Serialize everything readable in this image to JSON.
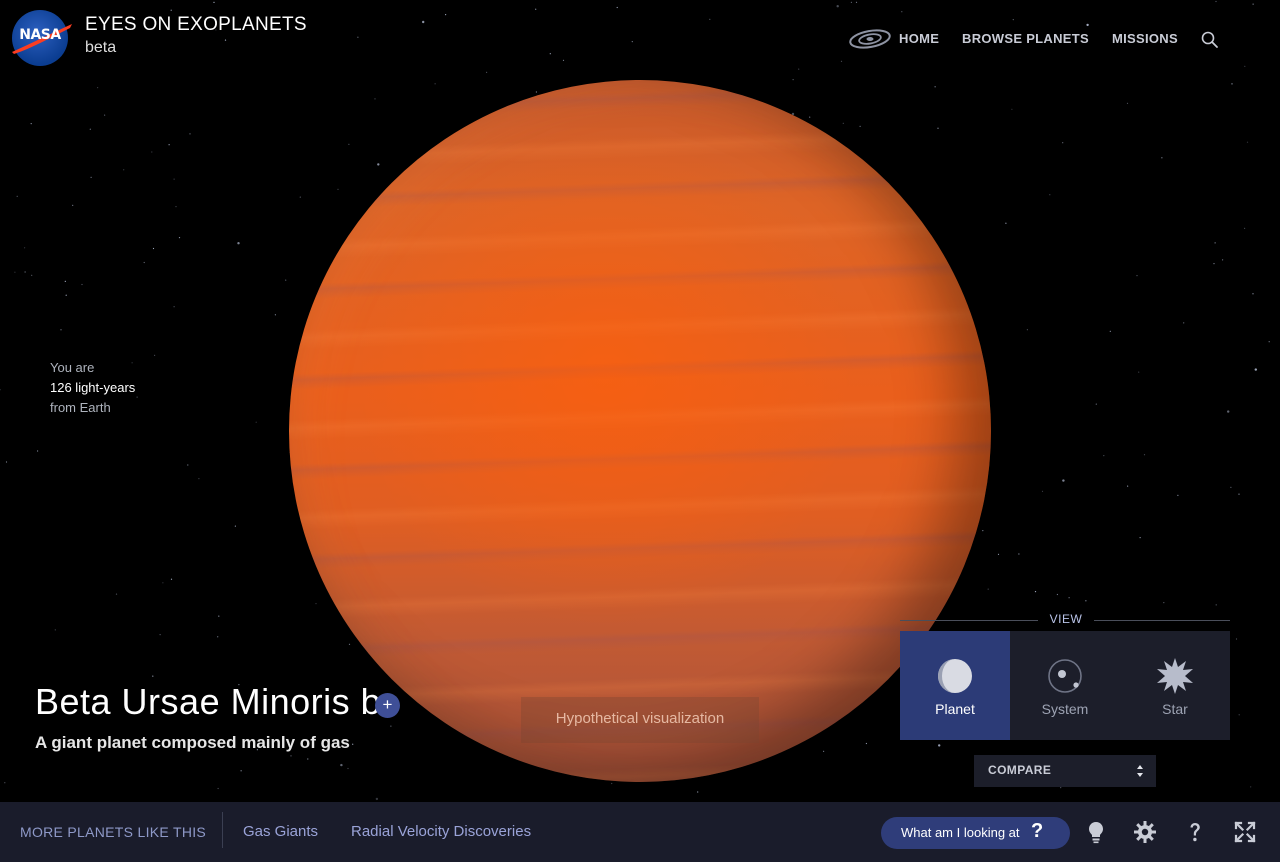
{
  "header": {
    "logo_text": "NASA",
    "title": "EYES ON EXOPLANETS",
    "subtitle": "beta"
  },
  "nav": {
    "galaxy_icon": "galaxy-icon",
    "items": [
      {
        "label": "HOME"
      },
      {
        "label": "BROWSE PLANETS"
      },
      {
        "label": "MISSIONS"
      }
    ],
    "search_icon": "search-icon"
  },
  "distance": {
    "line1": "You are",
    "line2": "126 light-years",
    "line3": "from Earth"
  },
  "planet": {
    "name": "Beta Ursae Minoris b",
    "add_label": "+",
    "description": "A giant planet composed mainly of gas",
    "hypothetical_label": "Hypothetical visualization",
    "colors": {
      "primary": "#e8611c",
      "band": "#9a5a5e"
    }
  },
  "view": {
    "label": "VIEW",
    "buttons": [
      {
        "label": "Planet",
        "icon": "planet-icon",
        "active": true
      },
      {
        "label": "System",
        "icon": "system-icon",
        "active": false
      },
      {
        "label": "Star",
        "icon": "star-icon",
        "active": false
      }
    ],
    "compare_label": "COMPARE"
  },
  "bottom": {
    "more_label": "MORE PLANETS LIKE THIS",
    "links": [
      {
        "label": "Gas Giants"
      },
      {
        "label": "Radial Velocity Discoveries"
      }
    ],
    "what_label": "What am I looking at",
    "what_glyph": "?",
    "icons": [
      "lightbulb-icon",
      "gear-icon",
      "help-icon",
      "fullscreen-icon"
    ]
  },
  "colors": {
    "accent": "#2c3b77",
    "bar_bg": "#1a1c2b",
    "link": "#9aa3d8"
  }
}
